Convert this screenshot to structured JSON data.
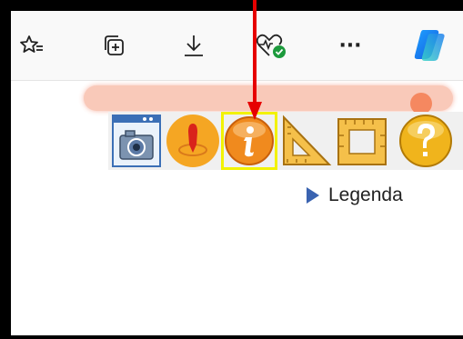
{
  "toolbar": {
    "icons": [
      "favorites-icon",
      "collections-icon",
      "downloads-icon",
      "browser-essentials-icon",
      "more-options-icon",
      "copilot-icon"
    ],
    "more_label": "···"
  },
  "slider": {
    "value_fraction": 0.96
  },
  "tools": [
    {
      "name": "screenshot-icon"
    },
    {
      "name": "location-pin-icon"
    },
    {
      "name": "info-icon",
      "selected": true
    },
    {
      "name": "triangle-ruler-icon"
    },
    {
      "name": "area-measure-icon"
    },
    {
      "name": "help-icon"
    }
  ],
  "legend": {
    "label": "Legenda"
  },
  "colors": {
    "accent_highlight": "#f2f200",
    "pointer": "#e60000",
    "slider_track": "#f9c4b2",
    "slider_knob": "#f57c4f",
    "tool_orange": "#f5a623"
  }
}
